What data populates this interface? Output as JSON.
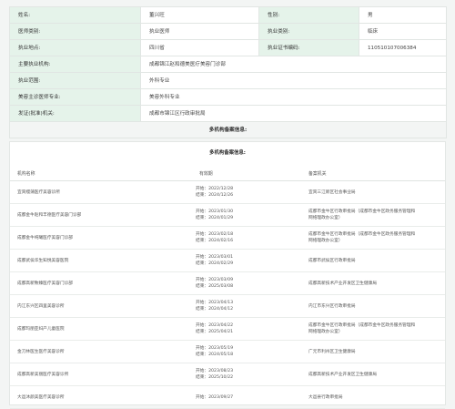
{
  "doctor": {
    "name": {
      "label": "姓名:",
      "value": "董兴旺"
    },
    "gender": {
      "label": "性别:",
      "value": "男"
    },
    "category": {
      "label": "医师类别:",
      "value": "执业医师"
    },
    "level": {
      "label": "执业类别:",
      "value": "临床"
    },
    "location": {
      "label": "执业地点:",
      "value": "四川省"
    },
    "cert": {
      "label": "执业证书编码:",
      "value": "110510107006384"
    },
    "main_institution": {
      "label": "主要执业机构:",
      "value": "成都锦江赵和德美医疗美容门诊部"
    },
    "scope": {
      "label": "执业范围:",
      "value": "外科专业"
    },
    "specialty": {
      "label": "美容主诊医师专业:",
      "value": "美容外科专业"
    },
    "authority": {
      "label": "发证(批准)机关:",
      "value": "成都市锦江区行政审批局"
    }
  },
  "section_title": "多机构备案信息:",
  "multi": {
    "title": "多机构备案信息:",
    "headers": [
      "机构名称",
      "有效期",
      "备案机关"
    ],
    "rows": [
      {
        "name": "宜宾缦蒲医疗美容诊所",
        "start": "开始：2022/12/28",
        "end": "结束：2024/12/26",
        "org": [
          "宜宾三江新区社会事业局"
        ]
      },
      {
        "name": "成都金牛赵和丰德医疗美容门诊部",
        "start": "开始：2023/01/30",
        "end": "结束：2024/01/29",
        "org": [
          "成都市金牛区行政审批局（成都市金牛区政务服务管理和",
          "网络理政办公室）"
        ]
      },
      {
        "name": "成都金牛纯曦医疗美容门诊部",
        "start": "开始：2023/02/18",
        "end": "结束：2024/02/16",
        "org": [
          "成都市金牛区行政审批局（成都市金牛区政务服务管理和",
          "网络理政办公室）"
        ]
      },
      {
        "name": "成都武侯华生知悦美容医院",
        "start": "开始：2023/03/01",
        "end": "结束：2024/02/29",
        "org": [
          "成都市武侯区行政审批局"
        ]
      },
      {
        "name": "成都高新致臻医疗美容门诊部",
        "start": "开始：2023/03/09",
        "end": "结束：2025/03/08",
        "org": [
          "成都高新技术产业开发区卫生健康局"
        ]
      },
      {
        "name": "内江东兴区四里美容诊所",
        "start": "开始：2023/04/13",
        "end": "结束：2024/04/12",
        "org": [
          "内江市东兴区行政审批局"
        ]
      },
      {
        "name": "成都玛丽亚妇产儿童医院",
        "start": "开始：2023/04/22",
        "end": "结束：2025/04/21",
        "org": [
          "成都市金牛区行政审批局（成都市金牛区政务服务管理和",
          "网络理政办公室）"
        ]
      },
      {
        "name": "金刀林医生医疗美容诊所",
        "start": "开始：2023/05/19",
        "end": "结束：2024/05/18",
        "org": [
          "广元市利州区卫生健康局"
        ]
      },
      {
        "name": "成都高新美丽医疗美容诊所",
        "start": "开始：2023/08/23",
        "end": "结束：2025/10/22",
        "org": [
          "成都高新技术产业开发区卫生健康局"
        ]
      },
      {
        "name": "大邑沐颜美医疗美容诊所",
        "start": "开始：2023/09/27",
        "end": "",
        "org": [
          "大邑县行政审批局"
        ]
      }
    ]
  }
}
